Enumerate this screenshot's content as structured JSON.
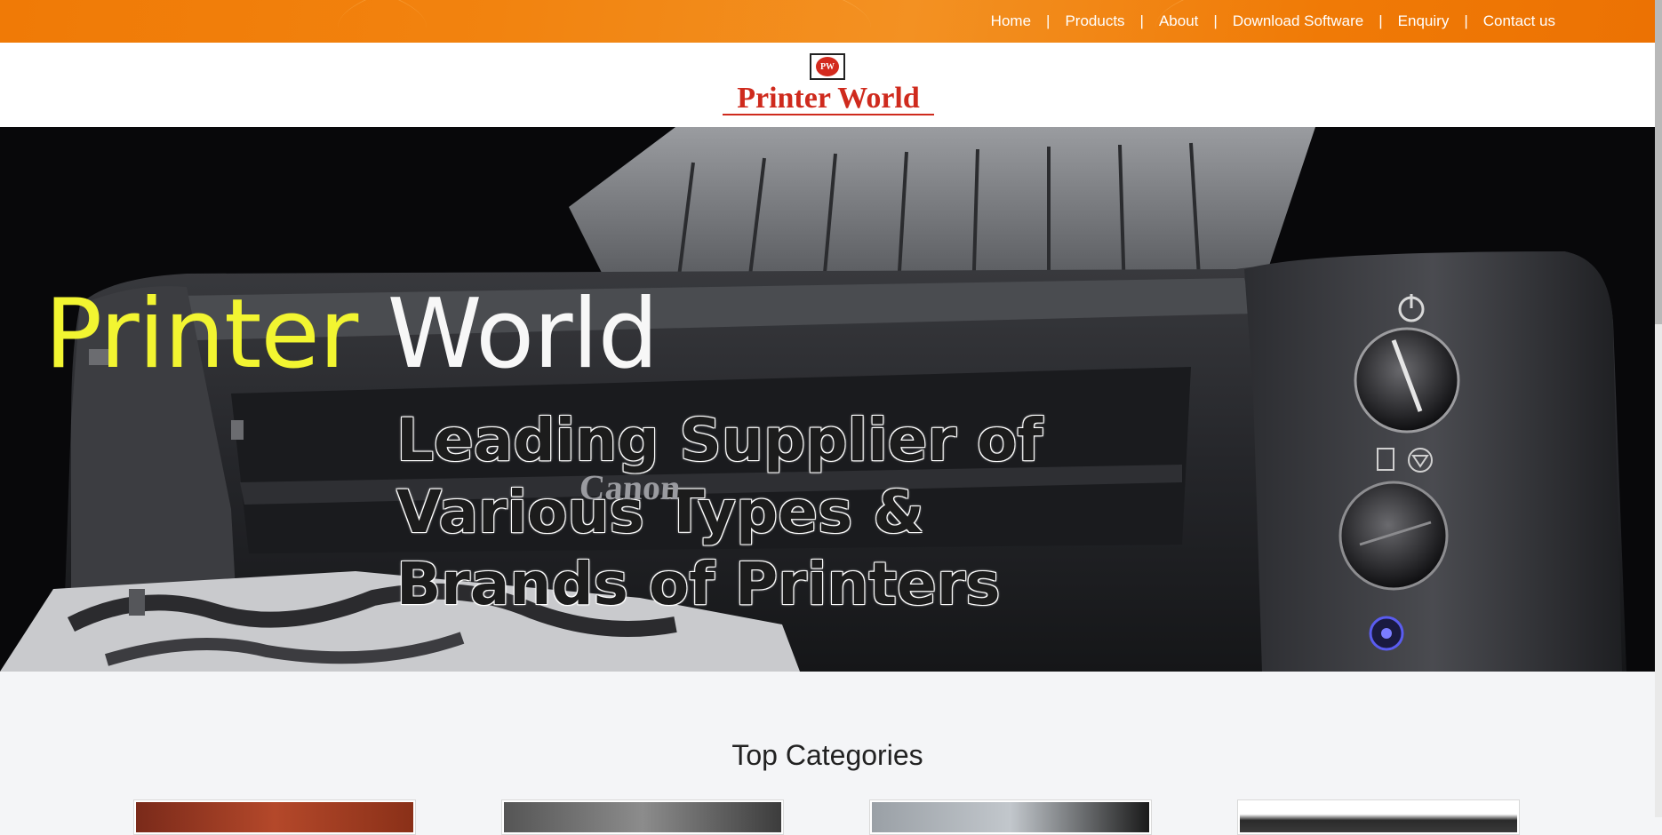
{
  "nav": {
    "items": [
      "Home",
      "Products",
      "About",
      "Download Software",
      "Enquiry",
      "Contact us"
    ],
    "separator": "|"
  },
  "logo": {
    "mark_text": "PW",
    "brand_name": "Printer World"
  },
  "hero": {
    "title_word1": "Printer",
    "title_word2": "World",
    "subtitle_lines": [
      "Leading Supplier of",
      "Various Types &",
      "Brands of Printers"
    ],
    "printer_brand": "Canon"
  },
  "categories": {
    "heading": "Top Categories"
  },
  "colors": {
    "topbar_orange": "#f07a06",
    "brand_red": "#cf2a1d",
    "hero_yellow": "#f2f531"
  }
}
